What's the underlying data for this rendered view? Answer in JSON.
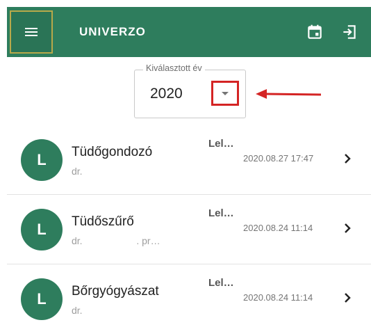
{
  "app": {
    "title": "UNIVERZO"
  },
  "icons": {
    "menu": "menu-icon",
    "calendar": "calendar-icon",
    "logout": "logout-icon",
    "dropdown": "caret-down-icon",
    "chevron": "chevron-right-icon",
    "annotation": "red-arrow-annotation"
  },
  "colors": {
    "primary": "#2e7d5d",
    "annotation": "#d42424"
  },
  "year_select": {
    "label": "Kiválasztott év",
    "value": "2020"
  },
  "items": [
    {
      "avatar": "L",
      "title": "Tüdőgondozó",
      "subtitle": "dr.",
      "status": "Lel…",
      "date": "2020.08.27 17:47"
    },
    {
      "avatar": "L",
      "title": "Tüdőszűrő",
      "subtitle": "dr.                    . pr…",
      "status": "Lel…",
      "date": "2020.08.24 11:14"
    },
    {
      "avatar": "L",
      "title": "Bőrgyógyászat",
      "subtitle": "dr.",
      "status": "Lel…",
      "date": "2020.08.24 11:14"
    }
  ]
}
